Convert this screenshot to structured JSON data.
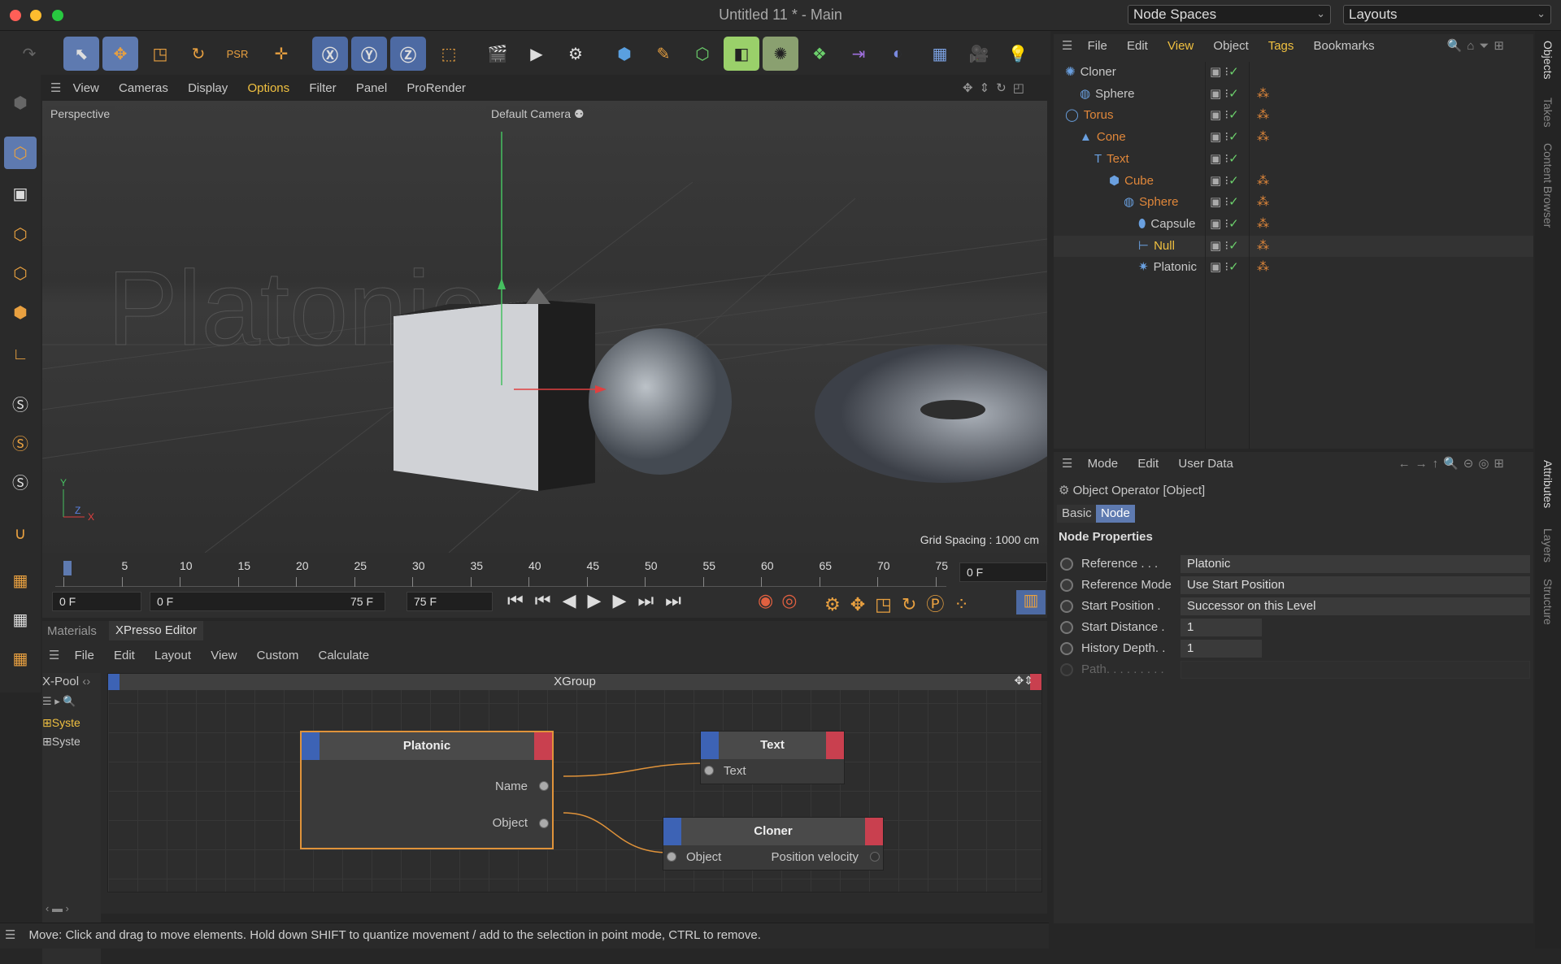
{
  "window": {
    "title": "Untitled 11 * - Main",
    "node_spaces": "Node Spaces",
    "layouts": "Layouts"
  },
  "viewport": {
    "menu": [
      "View",
      "Cameras",
      "Display",
      "Options",
      "Filter",
      "Panel",
      "ProRender"
    ],
    "mode_label": "Perspective",
    "camera_label": "Default Camera",
    "grid_spacing": "Grid Spacing : 1000 cm",
    "bg_text": "Platonic"
  },
  "timeline": {
    "ticks": [
      "0",
      "5",
      "10",
      "15",
      "20",
      "25",
      "30",
      "35",
      "40",
      "45",
      "50",
      "55",
      "60",
      "65",
      "70",
      "75"
    ],
    "current_frame": "0 F",
    "start_field": "0 F",
    "range_start": "0 F",
    "range_end": "75 F",
    "end_field": "75 F"
  },
  "bottom_tabs": {
    "materials": "Materials",
    "xpresso": "XPresso Editor"
  },
  "xpresso": {
    "menu": [
      "File",
      "Edit",
      "Layout",
      "View",
      "Custom",
      "Calculate"
    ],
    "pool_label": "X-Pool",
    "group_title": "XGroup",
    "tree": [
      "Syste",
      "Syste"
    ],
    "nodes": {
      "platonic": {
        "title": "Platonic",
        "ports": [
          "Name",
          "Object"
        ]
      },
      "text": {
        "title": "Text",
        "port": "Text"
      },
      "cloner": {
        "title": "Cloner",
        "in_port": "Object",
        "out_port": "Position velocity"
      }
    }
  },
  "status": "Move: Click and drag to move elements. Hold down SHIFT to quantize movement / add to the selection in point mode, CTRL to remove.",
  "objects": {
    "menu": [
      "File",
      "Edit",
      "View",
      "Object",
      "Tags",
      "Bookmarks"
    ],
    "tree": [
      {
        "name": "Cloner",
        "indent": 0,
        "color": "#c8c8c8"
      },
      {
        "name": "Sphere",
        "indent": 1,
        "color": "#c8c8c8"
      },
      {
        "name": "Torus",
        "indent": 0,
        "color": "#e0873a"
      },
      {
        "name": "Cone",
        "indent": 1,
        "color": "#e0873a"
      },
      {
        "name": "Text",
        "indent": 2,
        "color": "#e0873a"
      },
      {
        "name": "Cube",
        "indent": 3,
        "color": "#e0873a"
      },
      {
        "name": "Sphere",
        "indent": 4,
        "color": "#e0873a"
      },
      {
        "name": "Capsule",
        "indent": 5,
        "color": "#c8c8c8"
      },
      {
        "name": "Null",
        "indent": 5,
        "color": "#f0c040"
      },
      {
        "name": "Platonic",
        "indent": 5,
        "color": "#c8c8c8"
      }
    ]
  },
  "attributes": {
    "menu": [
      "Mode",
      "Edit",
      "User Data"
    ],
    "header": "Object Operator [Object]",
    "tabs": [
      "Basic",
      "Node"
    ],
    "section": "Node Properties",
    "props": [
      {
        "label": "Reference . . .",
        "value": "Platonic"
      },
      {
        "label": "Reference Mode",
        "value": "Use Start Position"
      },
      {
        "label": "Start Position .",
        "value": "Successor on this Level"
      },
      {
        "label": "Start Distance .",
        "value": "1"
      },
      {
        "label": "History Depth. .",
        "value": "1"
      },
      {
        "label": "Path. . . . . . . . .",
        "value": ""
      }
    ]
  },
  "side_tabs": [
    "Objects",
    "Takes",
    "Content Browser",
    "Attributes",
    "Layers",
    "Structure"
  ]
}
